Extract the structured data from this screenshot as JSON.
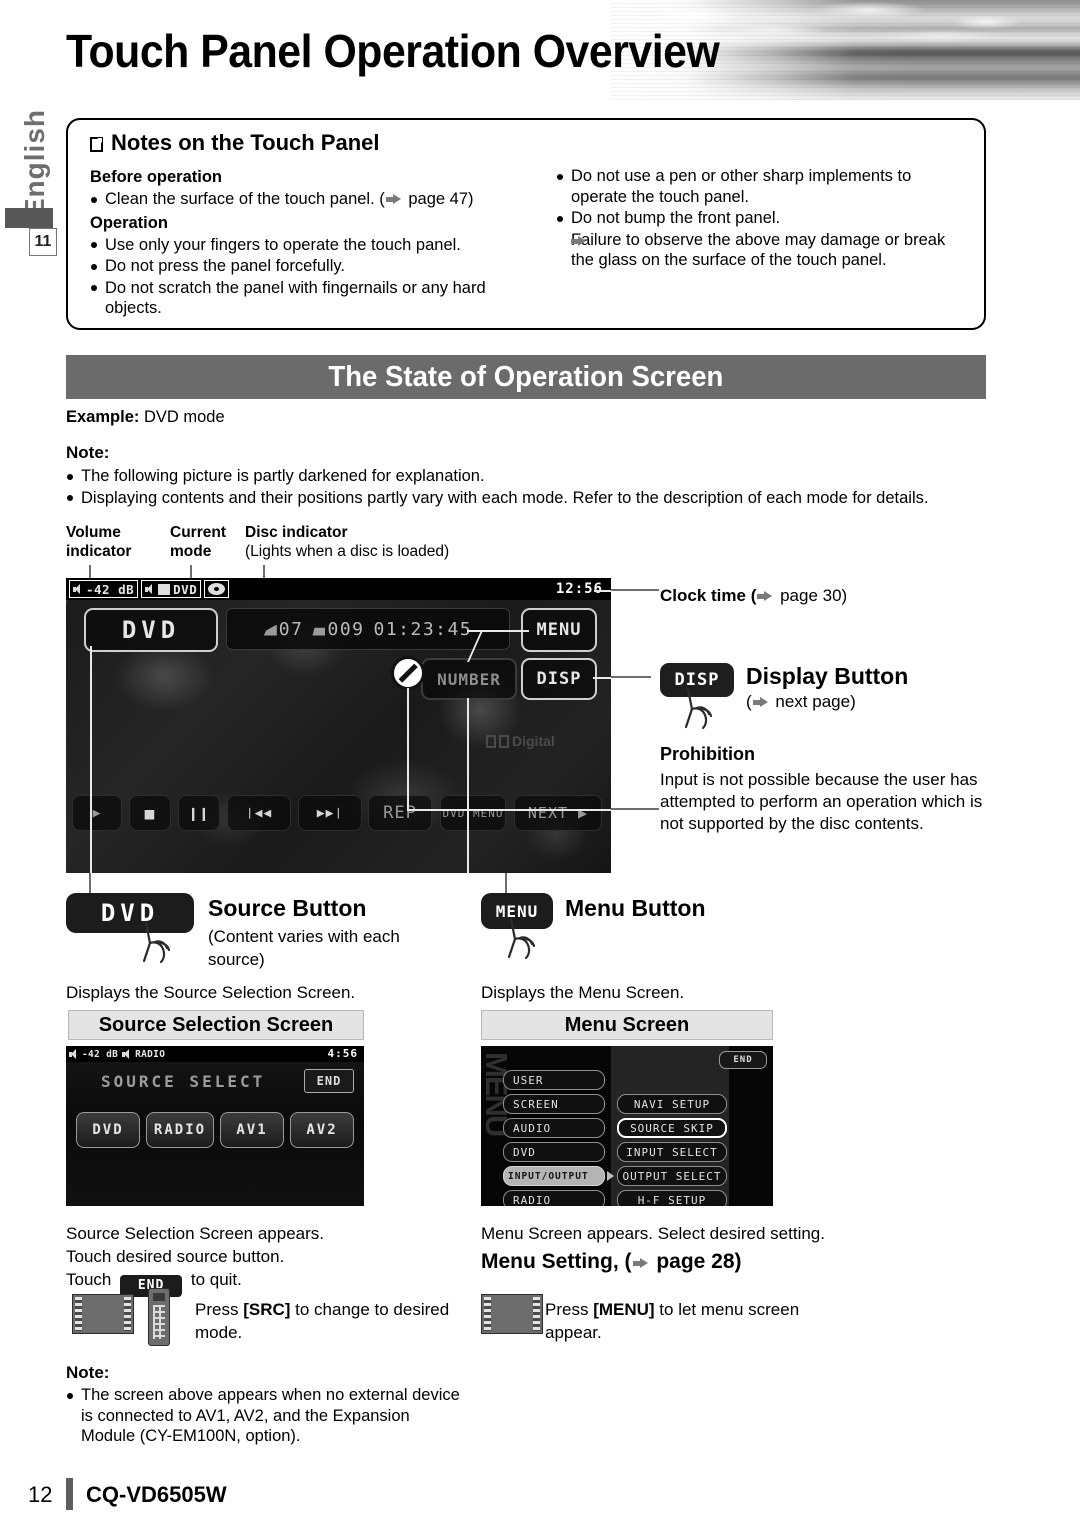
{
  "header": {
    "title": "Touch Panel Operation Overview",
    "language_tab": "English",
    "page_tab_number": "11"
  },
  "notes_panel": {
    "title": "Notes on the Touch Panel",
    "left": {
      "before_operation_head": "Before operation",
      "before_operation_items": [
        "Clean the surface of the touch panel.  (➡ page 47)"
      ],
      "before_operation_item_text": "Clean the surface of the touch panel.  (",
      "before_operation_item_tail": " page 47)",
      "operation_head": "Operation",
      "operation_items": [
        "Use only your fingers to operate the touch panel.",
        "Do not press the panel forcefully.",
        "Do not scratch the panel with fingernails or any hard objects."
      ]
    },
    "right": {
      "items": [
        "Do not use a pen or other sharp implements to operate the touch panel.",
        "Do not bump the front panel."
      ],
      "sub_item": "Failure to observe the above may damage or break the glass on the surface of the touch panel."
    }
  },
  "section": {
    "bar_title": "The State of Operation Screen",
    "example_label": "Example:",
    "example_value": " DVD mode",
    "note_head": "Note:",
    "note_items": [
      "The following picture is partly darkened for explanation.",
      "Displaying contents and their positions partly vary with each mode. Refer to the description of each mode for details."
    ]
  },
  "screen_callouts": {
    "volume_indicator": "Volume indicator",
    "volume_indicator_l1": "Volume",
    "volume_indicator_l2": "indicator",
    "current_mode_l1": "Current",
    "current_mode_l2": "mode",
    "disc_indicator_title": "Disc indicator",
    "disc_indicator_sub": "(Lights when a disc is loaded)",
    "clock_time_label": "Clock time (",
    "clock_time_page": " page 30)",
    "display_button": {
      "button_label": "DISP",
      "title": "Display Button",
      "sub_prefix": "(",
      "sub_suffix": " next page)"
    },
    "prohibition": {
      "title": "Prohibition",
      "body": "Input is not possible because the user has attempted to perform an operation which is not supported by the disc contents."
    }
  },
  "dvd_screen": {
    "volume_value": "-42 dB",
    "mode_value": "DVD",
    "clock": "12:56",
    "source_button": "DVD",
    "menu_button": "MENU",
    "disp_button": "DISP",
    "number_button": "NUMBER",
    "time_chapter": "07",
    "time_track": "009",
    "time_elapsed": "01:23:45",
    "dolby_label": "Digital",
    "bottom_buttons": [
      {
        "icon": "play-icon",
        "label": "▶"
      },
      {
        "icon": "stop-icon",
        "label": "■"
      },
      {
        "icon": "pause-icon",
        "label": "❙❙"
      },
      {
        "icon": "previous-track-icon",
        "label": "❘◀◀"
      },
      {
        "icon": "next-track-icon",
        "label": "▶▶❘"
      },
      {
        "icon": "repeat-icon",
        "label": "REP"
      },
      {
        "icon": "dvd-menu-icon",
        "label": "DVD MENU"
      },
      {
        "icon": "next-page-icon",
        "label": "NEXT ▶"
      }
    ]
  },
  "source_block": {
    "button_label": "DVD",
    "title": "Source Button",
    "sub": "(Content varies with each source)",
    "displays_text": "Displays the Source Selection Screen.",
    "screen_title": "Source Selection Screen",
    "after_line1": "Source Selection Screen appears.",
    "after_line2": "Touch desired source button.",
    "after_line3_pre": "Touch",
    "after_line3_chip": "END",
    "after_line3_post": "to quit.",
    "press_text_pre": "Press ",
    "press_text_key": "[SRC]",
    "press_text_post": " to change to desired mode.",
    "note_head": "Note:",
    "note_item": "The screen above appears when no external device is connected to AV1, AV2, and the Expansion Module (CY-EM100N, option)."
  },
  "source_screen": {
    "volume_value": "-42 dB",
    "mode_value": "RADIO",
    "clock": "4:56",
    "heading": "SOURCE SELECT",
    "end_button": "END",
    "options": [
      "DVD",
      "RADIO",
      "AV1",
      "AV2"
    ]
  },
  "menu_block": {
    "button_label": "MENU",
    "title": "Menu Button",
    "displays_text": "Displays the Menu Screen.",
    "screen_title": "Menu Screen",
    "after_line": "Menu Screen appears. Select desired setting.",
    "menu_setting_pre": "Menu Setting, (",
    "menu_setting_post": " page 28)",
    "press_text_pre": "Press ",
    "press_text_key": "[MENU]",
    "press_text_post": " to let menu screen appear."
  },
  "menu_screen": {
    "watermark": "MENU",
    "end_button": "END",
    "left_column": [
      "USER",
      "SCREEN",
      "AUDIO",
      "DVD",
      "INPUT/OUTPUT",
      "RADIO"
    ],
    "highlighted_left_item": "INPUT/OUTPUT",
    "right_column": [
      "NAVI  SETUP",
      "SOURCE  SKIP",
      "INPUT  SELECT",
      "OUTPUT  SELECT",
      "H-F  SETUP"
    ],
    "selected_right_item": "SOURCE  SKIP"
  },
  "footer": {
    "page_number": "12",
    "model": "CQ-VD6505W"
  },
  "colors": {
    "section_bar": "#6b6b6b",
    "screen_title_bg": "#e4e4e4",
    "lang_text": "#6e6e6e",
    "arrow": "#7a7a7a"
  }
}
